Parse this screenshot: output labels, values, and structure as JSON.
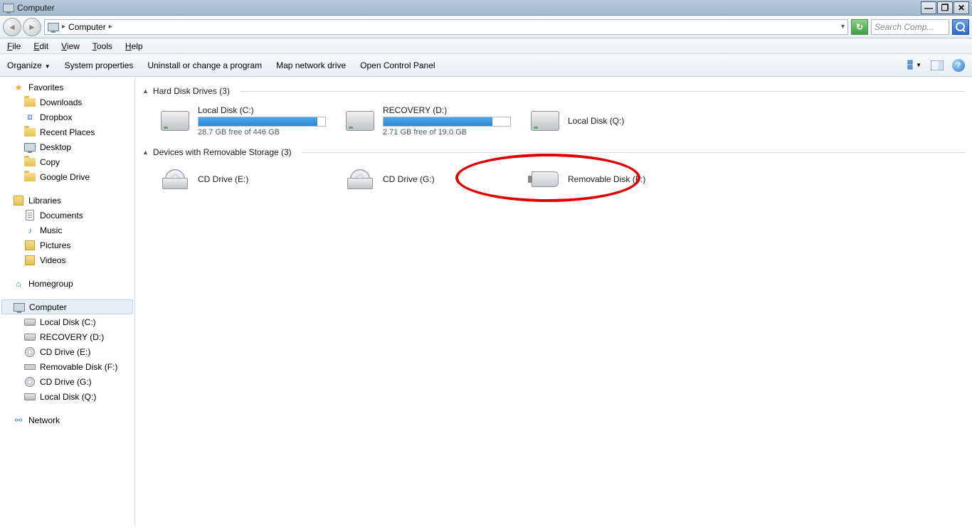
{
  "window": {
    "title": "Computer"
  },
  "address": {
    "location": "Computer"
  },
  "search": {
    "placeholder": "Search Comp..."
  },
  "menu": {
    "file": "File",
    "edit": "Edit",
    "view": "View",
    "tools": "Tools",
    "help": "Help"
  },
  "commands": {
    "organize": "Organize",
    "system_properties": "System properties",
    "uninstall": "Uninstall or change a program",
    "map_drive": "Map network drive",
    "control_panel": "Open Control Panel"
  },
  "sidebar": {
    "favorites": {
      "label": "Favorites",
      "items": [
        "Downloads",
        "Dropbox",
        "Recent Places",
        "Desktop",
        "Copy",
        "Google Drive"
      ]
    },
    "libraries": {
      "label": "Libraries",
      "items": [
        "Documents",
        "Music",
        "Pictures",
        "Videos"
      ]
    },
    "homegroup": {
      "label": "Homegroup"
    },
    "computer": {
      "label": "Computer",
      "items": [
        "Local Disk (C:)",
        "RECOVERY (D:)",
        "CD Drive (E:)",
        "Removable Disk (F:)",
        "CD Drive (G:)",
        "Local Disk (Q:)"
      ]
    },
    "network": {
      "label": "Network"
    }
  },
  "sections": {
    "hdd": {
      "label": "Hard Disk Drives (3)"
    },
    "removable": {
      "label": "Devices with Removable Storage (3)"
    }
  },
  "drives": {
    "c": {
      "name": "Local Disk (C:)",
      "free": "28.7 GB free of 446 GB",
      "fill_pct": 94
    },
    "d": {
      "name": "RECOVERY (D:)",
      "free": "2.71 GB free of 19.0 GB",
      "fill_pct": 86
    },
    "q": {
      "name": "Local Disk (Q:)"
    },
    "e": {
      "name": "CD Drive (E:)"
    },
    "g": {
      "name": "CD Drive (G:)"
    },
    "f": {
      "name": "Removable Disk (F:)"
    }
  }
}
